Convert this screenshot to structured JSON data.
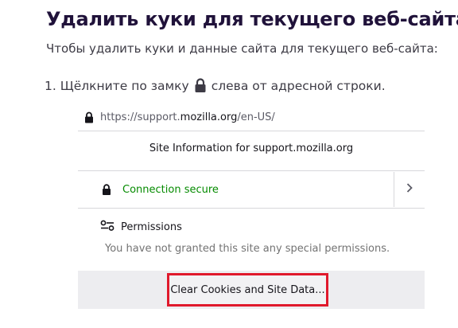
{
  "article": {
    "title": "Удалить куки для текущего веб-сайта",
    "intro": "Чтобы удалить куки и данные сайта для текущего веб-сайта:",
    "step_number": "1.",
    "step_text_before": "Щёлкните по замку",
    "step_text_after": "слева от адресной строки."
  },
  "urlbar": {
    "prefix": "https://support.",
    "domain": "mozilla.org",
    "suffix": "/en-US/"
  },
  "panel": {
    "title": "Site Information for support.mozilla.org",
    "connection_label": "Connection secure",
    "permissions_label": "Permissions",
    "permissions_note": "You have not granted this site any special permissions.",
    "clear_button": "Clear Cookies and Site Data..."
  },
  "icons": [
    "lock-icon",
    "chevron-right-icon",
    "permissions-icon"
  ],
  "colors": {
    "title": "#20123a",
    "secure_green": "#058b00",
    "highlight_red": "#e0192c"
  }
}
